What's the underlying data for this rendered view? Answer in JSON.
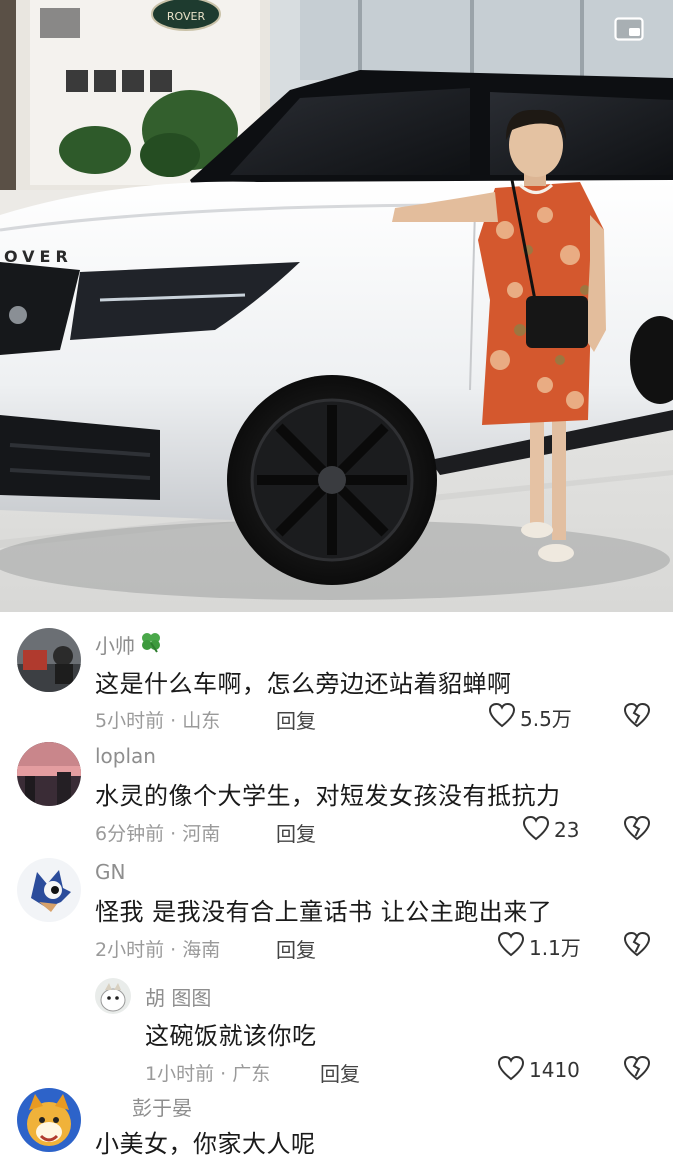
{
  "comments": [
    {
      "username": "小帅",
      "username_badge_icon": "clover-icon",
      "text": "这是什么车啊，怎么旁边还站着貂蝉啊",
      "meta": "5小时前 · 山东",
      "reply_label": "回复",
      "like_count": "5.5万"
    },
    {
      "username": "loplan",
      "text": "水灵的像个大学生，对短发女孩没有抵抗力",
      "meta": "6分钟前 · 河南",
      "reply_label": "回复",
      "like_count": "23"
    },
    {
      "username": "GN",
      "text": "怪我 是我没有合上童话书 让公主跑出来了",
      "meta": "2小时前 · 海南",
      "reply_label": "回复",
      "like_count": "1.1万"
    },
    {
      "username": "胡 图图",
      "text": "这碗饭就该你吃",
      "meta": "1小时前 · 广东",
      "reply_label": "回复",
      "like_count": "1410",
      "is_reply": true
    },
    {
      "username": "彭于晏",
      "text": "小美女，你家大人呢"
    }
  ],
  "photo": {
    "car_badge_text": "OVER",
    "dealer_logo_text": "ROVER",
    "icons": [
      "picture-in-picture-icon",
      "heart-icon",
      "broken-heart-icon"
    ]
  }
}
